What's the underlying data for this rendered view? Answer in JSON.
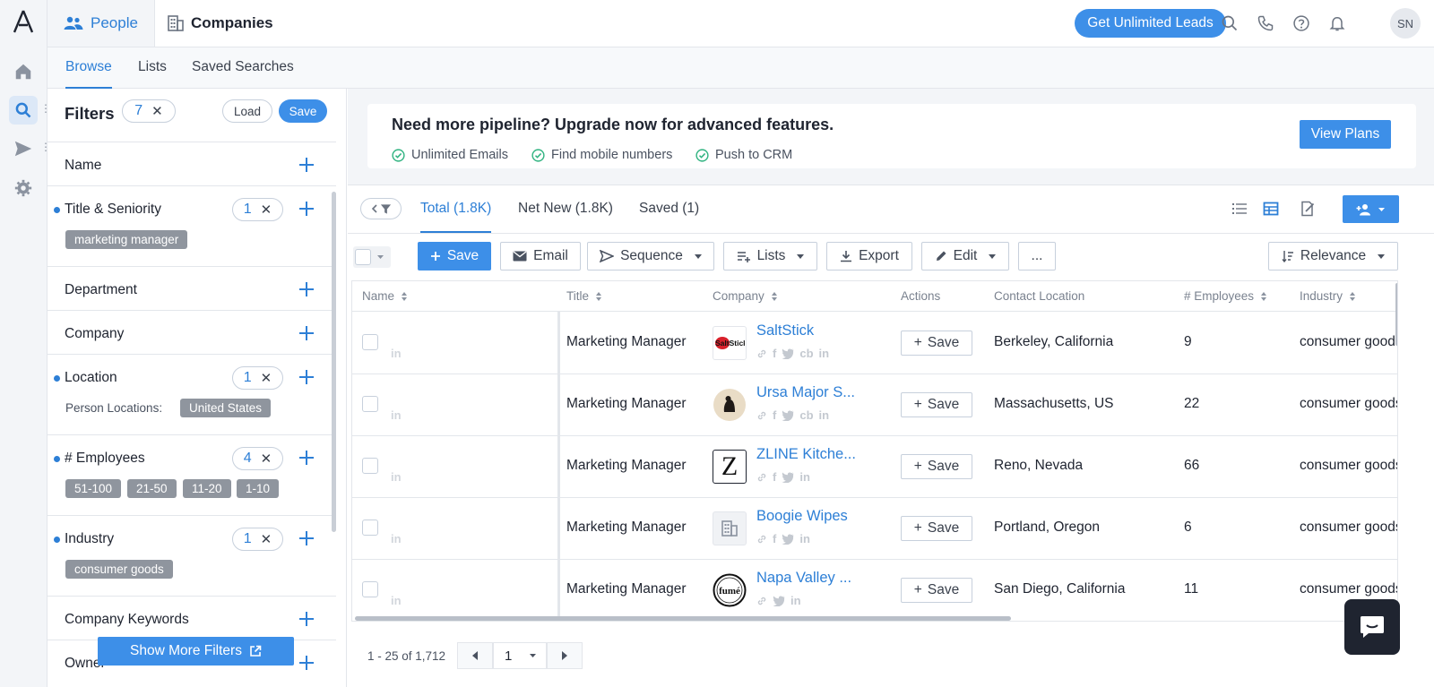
{
  "app": {
    "top_tabs": [
      {
        "label": "People",
        "icon": "people-icon"
      },
      {
        "label": "Companies",
        "icon": "building-icon"
      }
    ],
    "cta_label": "Get Unlimited Leads",
    "avatar_initials": "SN"
  },
  "sub_tabs": [
    "Browse",
    "Lists",
    "Saved Searches"
  ],
  "filters": {
    "title": "Filters",
    "active_count": "7",
    "load_label": "Load",
    "save_label": "Save",
    "sections": [
      {
        "label": "Name"
      },
      {
        "label": "Title & Seniority",
        "count": "1",
        "chips": [
          "marketing manager"
        ]
      },
      {
        "label": "Department"
      },
      {
        "label": "Company"
      },
      {
        "label": "Location",
        "count": "1",
        "sub_label": "Person Locations:",
        "chips": [
          "United States"
        ]
      },
      {
        "label": "# Employees",
        "count": "4",
        "chips": [
          "51-100",
          "21-50",
          "11-20",
          "1-10"
        ]
      },
      {
        "label": "Industry",
        "count": "1",
        "chips": [
          "consumer goods"
        ]
      },
      {
        "label": "Company Keywords"
      },
      {
        "label": "Owner"
      }
    ],
    "show_more_label": "Show More Filters"
  },
  "banner": {
    "title": "Need more pipeline? Upgrade now for advanced features.",
    "features": [
      "Unlimited Emails",
      "Find mobile numbers",
      "Push to CRM"
    ],
    "button_label": "View Plans"
  },
  "results": {
    "tabs": [
      "Total (1.8K)",
      "Net New (1.8K)",
      "Saved (1)"
    ],
    "toolbar": {
      "save": "Save",
      "email": "Email",
      "sequence": "Sequence",
      "lists": "Lists",
      "export": "Export",
      "edit": "Edit",
      "more": "...",
      "sort": "Relevance"
    },
    "columns": [
      "Name",
      "Title",
      "Company",
      "Actions",
      "Contact Location",
      "# Employees",
      "Industry"
    ],
    "rows": [
      {
        "title": "Marketing Manager",
        "company": "SaltStick",
        "logo_text": "SaltStick",
        "logo": "saltstick",
        "socials": [
          "link",
          "f",
          "t",
          "cb",
          "in"
        ],
        "action": "Save",
        "location": "Berkeley, California",
        "employees": "9",
        "industry": "consumer goods"
      },
      {
        "title": "Marketing Manager",
        "company": "Ursa Major S...",
        "logo": "ursa",
        "socials": [
          "link",
          "f",
          "t",
          "cb",
          "in"
        ],
        "action": "Save",
        "location": "Massachusetts, US",
        "employees": "22",
        "industry": "consumer goods"
      },
      {
        "title": "Marketing Manager",
        "company": "ZLINE Kitche...",
        "logo_text": "Z",
        "logo": "zline",
        "socials": [
          "link",
          "f",
          "t",
          "in"
        ],
        "action": "Save",
        "location": "Reno, Nevada",
        "employees": "66",
        "industry": "consumer goods"
      },
      {
        "title": "Marketing Manager",
        "company": "Boogie Wipes",
        "logo": "building",
        "socials": [
          "link",
          "f",
          "t",
          "in"
        ],
        "action": "Save",
        "location": "Portland, Oregon",
        "employees": "6",
        "industry": "consumer goods"
      },
      {
        "title": "Marketing Manager",
        "company": "Napa Valley ...",
        "logo_text": "fumé",
        "logo": "napa",
        "socials": [
          "link",
          "t",
          "in"
        ],
        "action": "Save",
        "location": "San Diego, California",
        "employees": "11",
        "industry": "consumer goods"
      }
    ],
    "pagination": {
      "range": "1 - 25 of 1,712",
      "page": "1"
    }
  },
  "colors": {
    "accent": "#3d8fe8",
    "link": "#2d7fd6",
    "chip": "#8f959e",
    "success": "#2fb380"
  }
}
